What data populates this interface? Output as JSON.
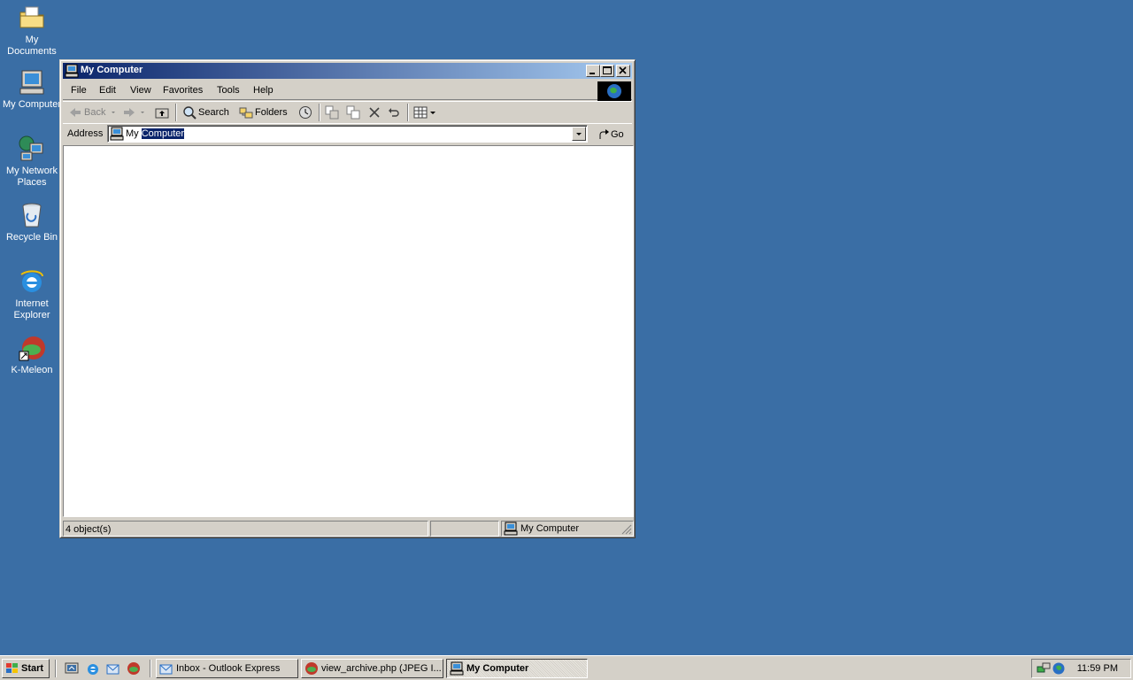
{
  "desktop": {
    "icons": [
      {
        "label": "My Documents"
      },
      {
        "label": "My Computer"
      },
      {
        "label": "My Network Places"
      },
      {
        "label": "Recycle Bin"
      },
      {
        "label": "Internet Explorer"
      },
      {
        "label": "K-Meleon"
      }
    ]
  },
  "window": {
    "title": "My Computer",
    "menu": [
      "File",
      "Edit",
      "View",
      "Favorites",
      "Tools",
      "Help"
    ],
    "toolbar": {
      "back_label": "Back",
      "search_label": "Search",
      "folders_label": "Folders"
    },
    "address": {
      "label": "Address",
      "value_prefix": "My",
      "value_selected": "Computer",
      "go_label": "Go"
    },
    "status": {
      "objects": "4 object(s)",
      "location": "My Computer"
    }
  },
  "taskbar": {
    "start_label": "Start",
    "tasks": [
      {
        "label": "Inbox - Outlook Express",
        "active": false
      },
      {
        "label": "view_archive.php (JPEG I...",
        "active": false
      },
      {
        "label": "My Computer",
        "active": true
      }
    ],
    "clock": "11:59 PM"
  },
  "colors": {
    "desktop": "#3a6ea5",
    "title_active_start": "#0a246a",
    "title_active_end": "#a6caf0",
    "face": "#d4d0c8"
  }
}
